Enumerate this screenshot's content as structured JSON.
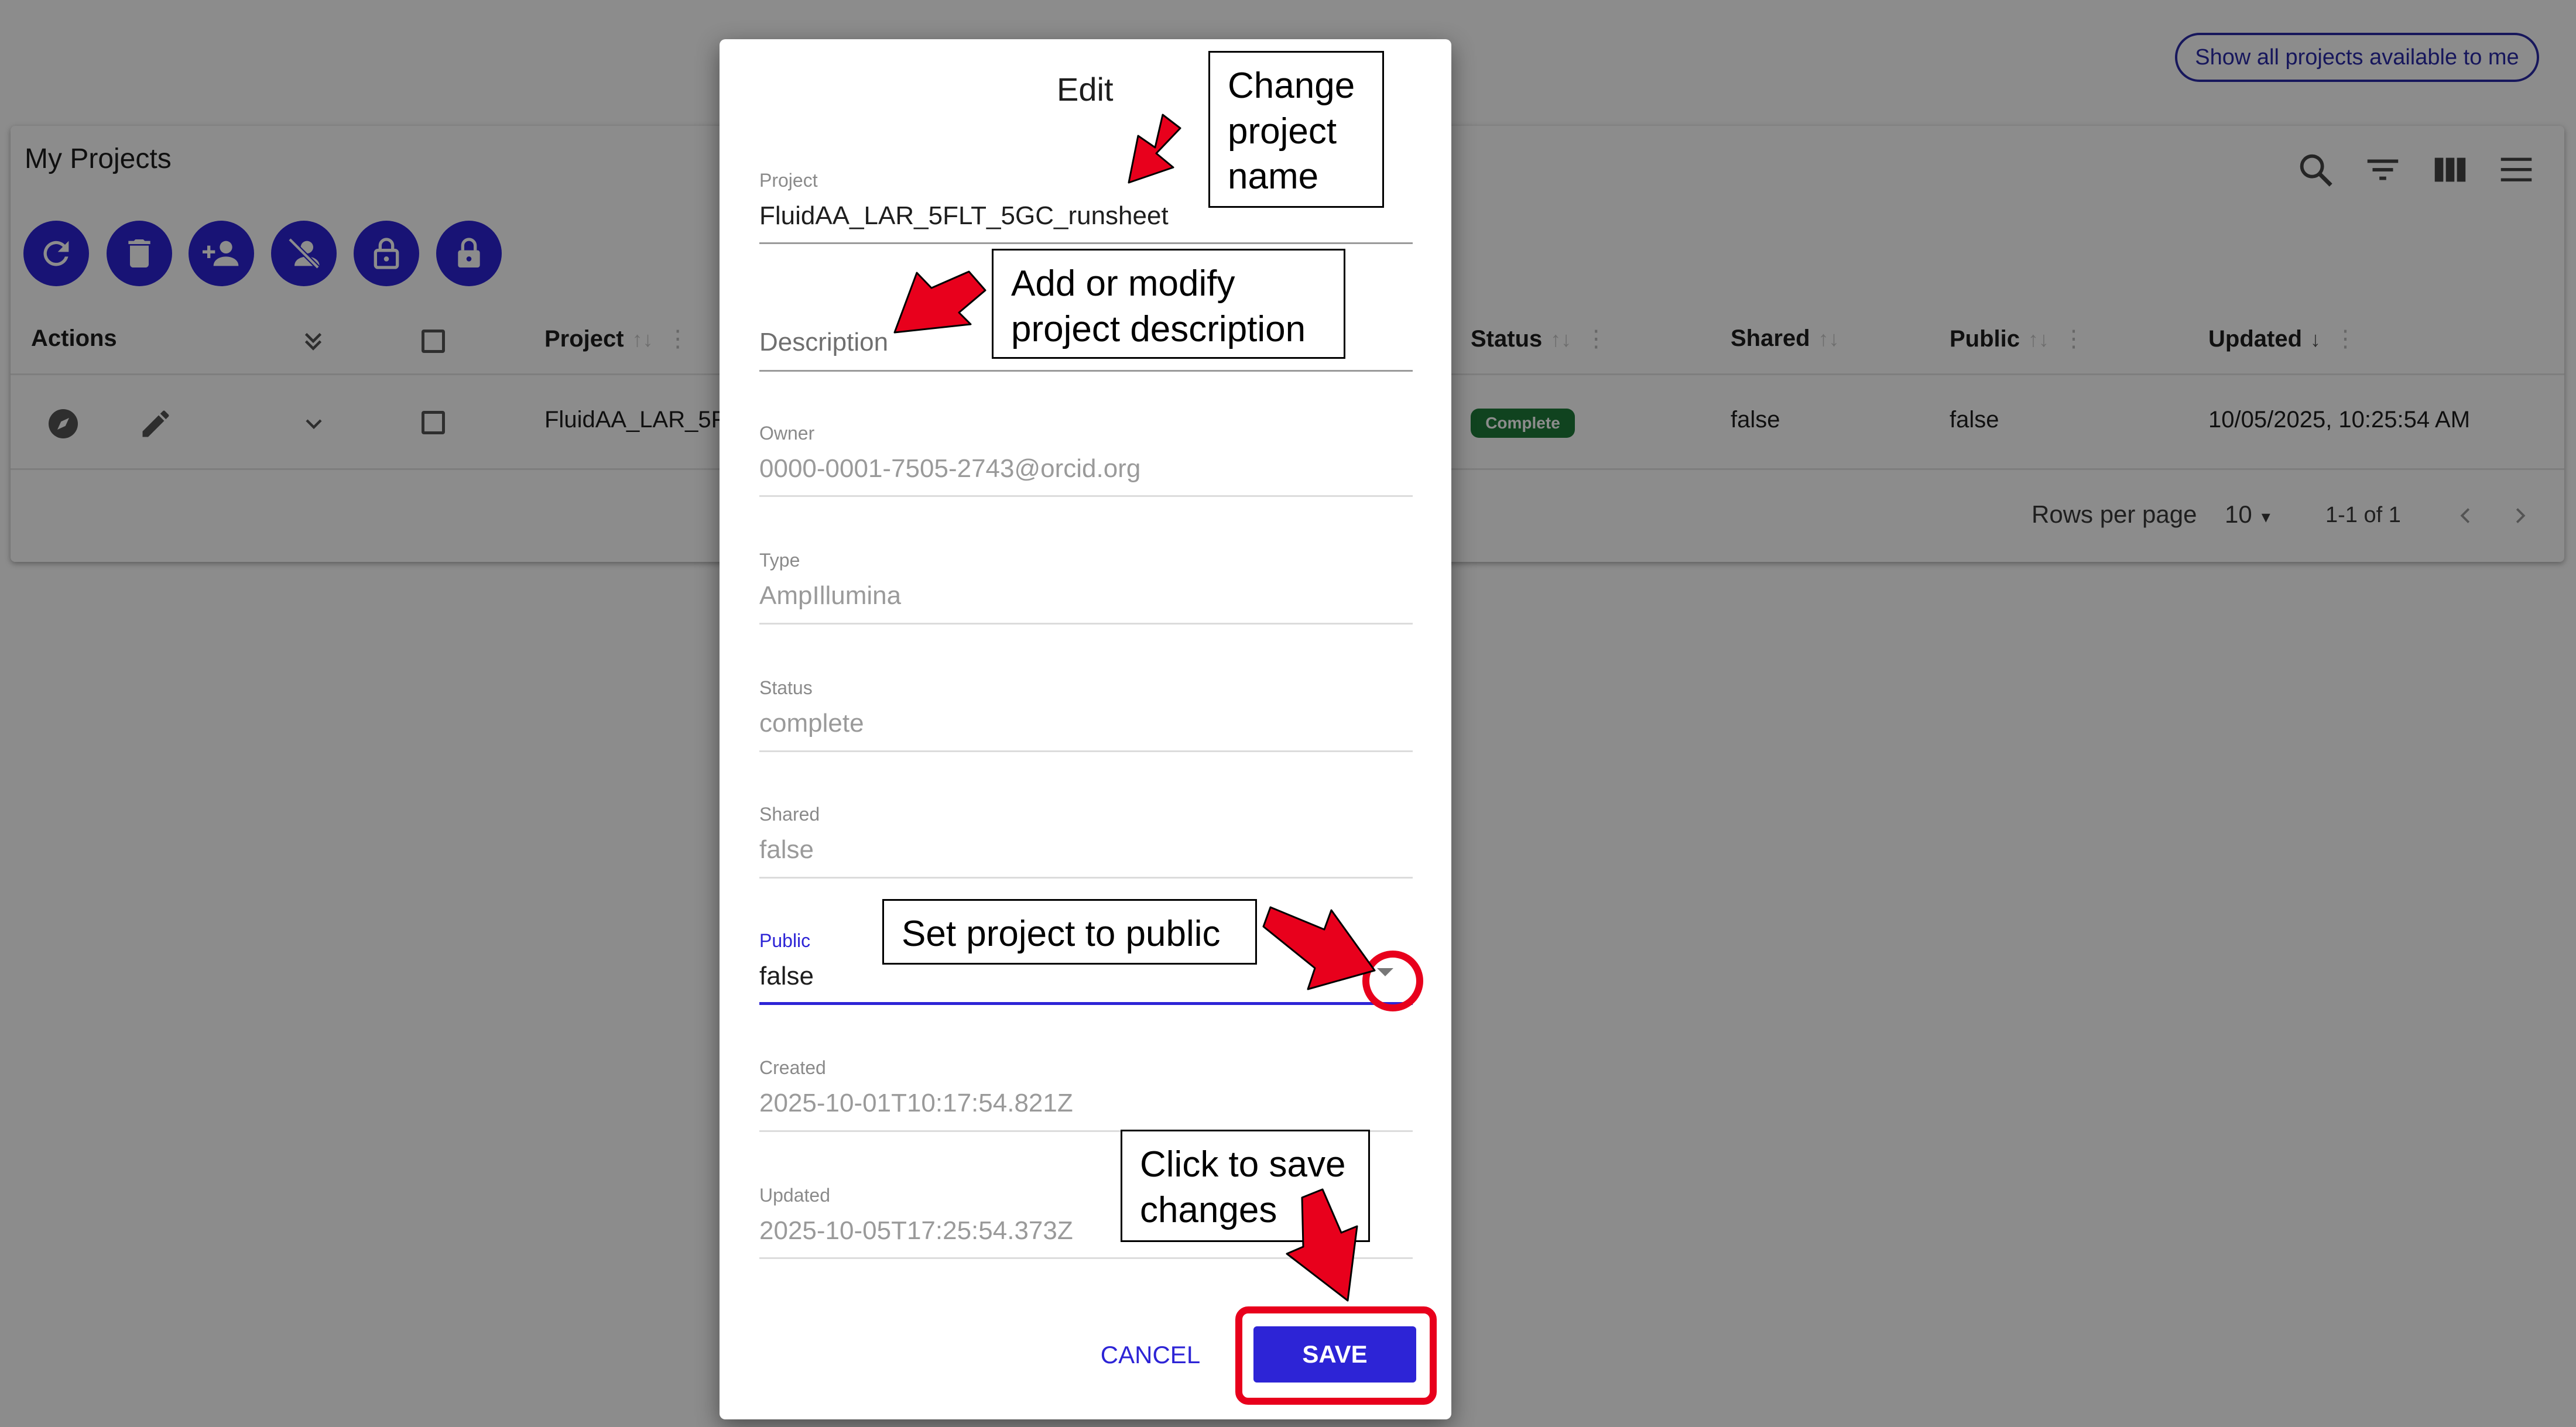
{
  "header": {
    "show_all_button": "Show all projects available to me"
  },
  "projects_table": {
    "title": "My Projects",
    "toolbar_icons": [
      "search-icon",
      "filter-icon",
      "view-columns-icon",
      "menu-icon"
    ],
    "action_buttons": [
      "refresh-icon",
      "delete-icon",
      "add-user-icon",
      "remove-user-icon",
      "unlock-icon",
      "lock-icon"
    ],
    "columns": {
      "actions": "Actions",
      "project": "Project",
      "status": "Status",
      "shared": "Shared",
      "public": "Public",
      "updated": "Updated"
    },
    "row": {
      "project": "FluidAA_LAR_5F",
      "status": "Complete",
      "shared": "false",
      "public": "false",
      "updated": "10/05/2025, 10:25:54 AM"
    },
    "pagination": {
      "rows_per_page_label": "Rows per page",
      "rows_per_page_value": "10",
      "range": "1-1 of 1"
    },
    "status_color": "#1e7a3a",
    "accent_color": "#2d24d6"
  },
  "dialog": {
    "title": "Edit",
    "fields": {
      "project": {
        "label": "Project",
        "value": "FluidAA_LAR_5FLT_5GC_runsheet"
      },
      "description": {
        "placeholder": "Description"
      },
      "owner": {
        "label": "Owner",
        "value": "0000-0001-7505-2743@orcid.org"
      },
      "type": {
        "label": "Type",
        "value": "AmpIllumina"
      },
      "status": {
        "label": "Status",
        "value": "complete"
      },
      "shared": {
        "label": "Shared",
        "value": "false"
      },
      "public": {
        "label": "Public",
        "value": "false"
      },
      "created": {
        "label": "Created",
        "value": "2025-10-01T10:17:54.821Z"
      },
      "updated": {
        "label": "Updated",
        "value": "2025-10-05T17:25:54.373Z"
      }
    },
    "cancel_label": "CANCEL",
    "save_label": "SAVE"
  },
  "annotations": {
    "change_name": [
      "Change",
      "project",
      "name"
    ],
    "description": [
      "Add or modify",
      "project description"
    ],
    "public": "Set project to public",
    "save": [
      "Click to save",
      "changes"
    ],
    "highlight_color": "#e8001c"
  }
}
